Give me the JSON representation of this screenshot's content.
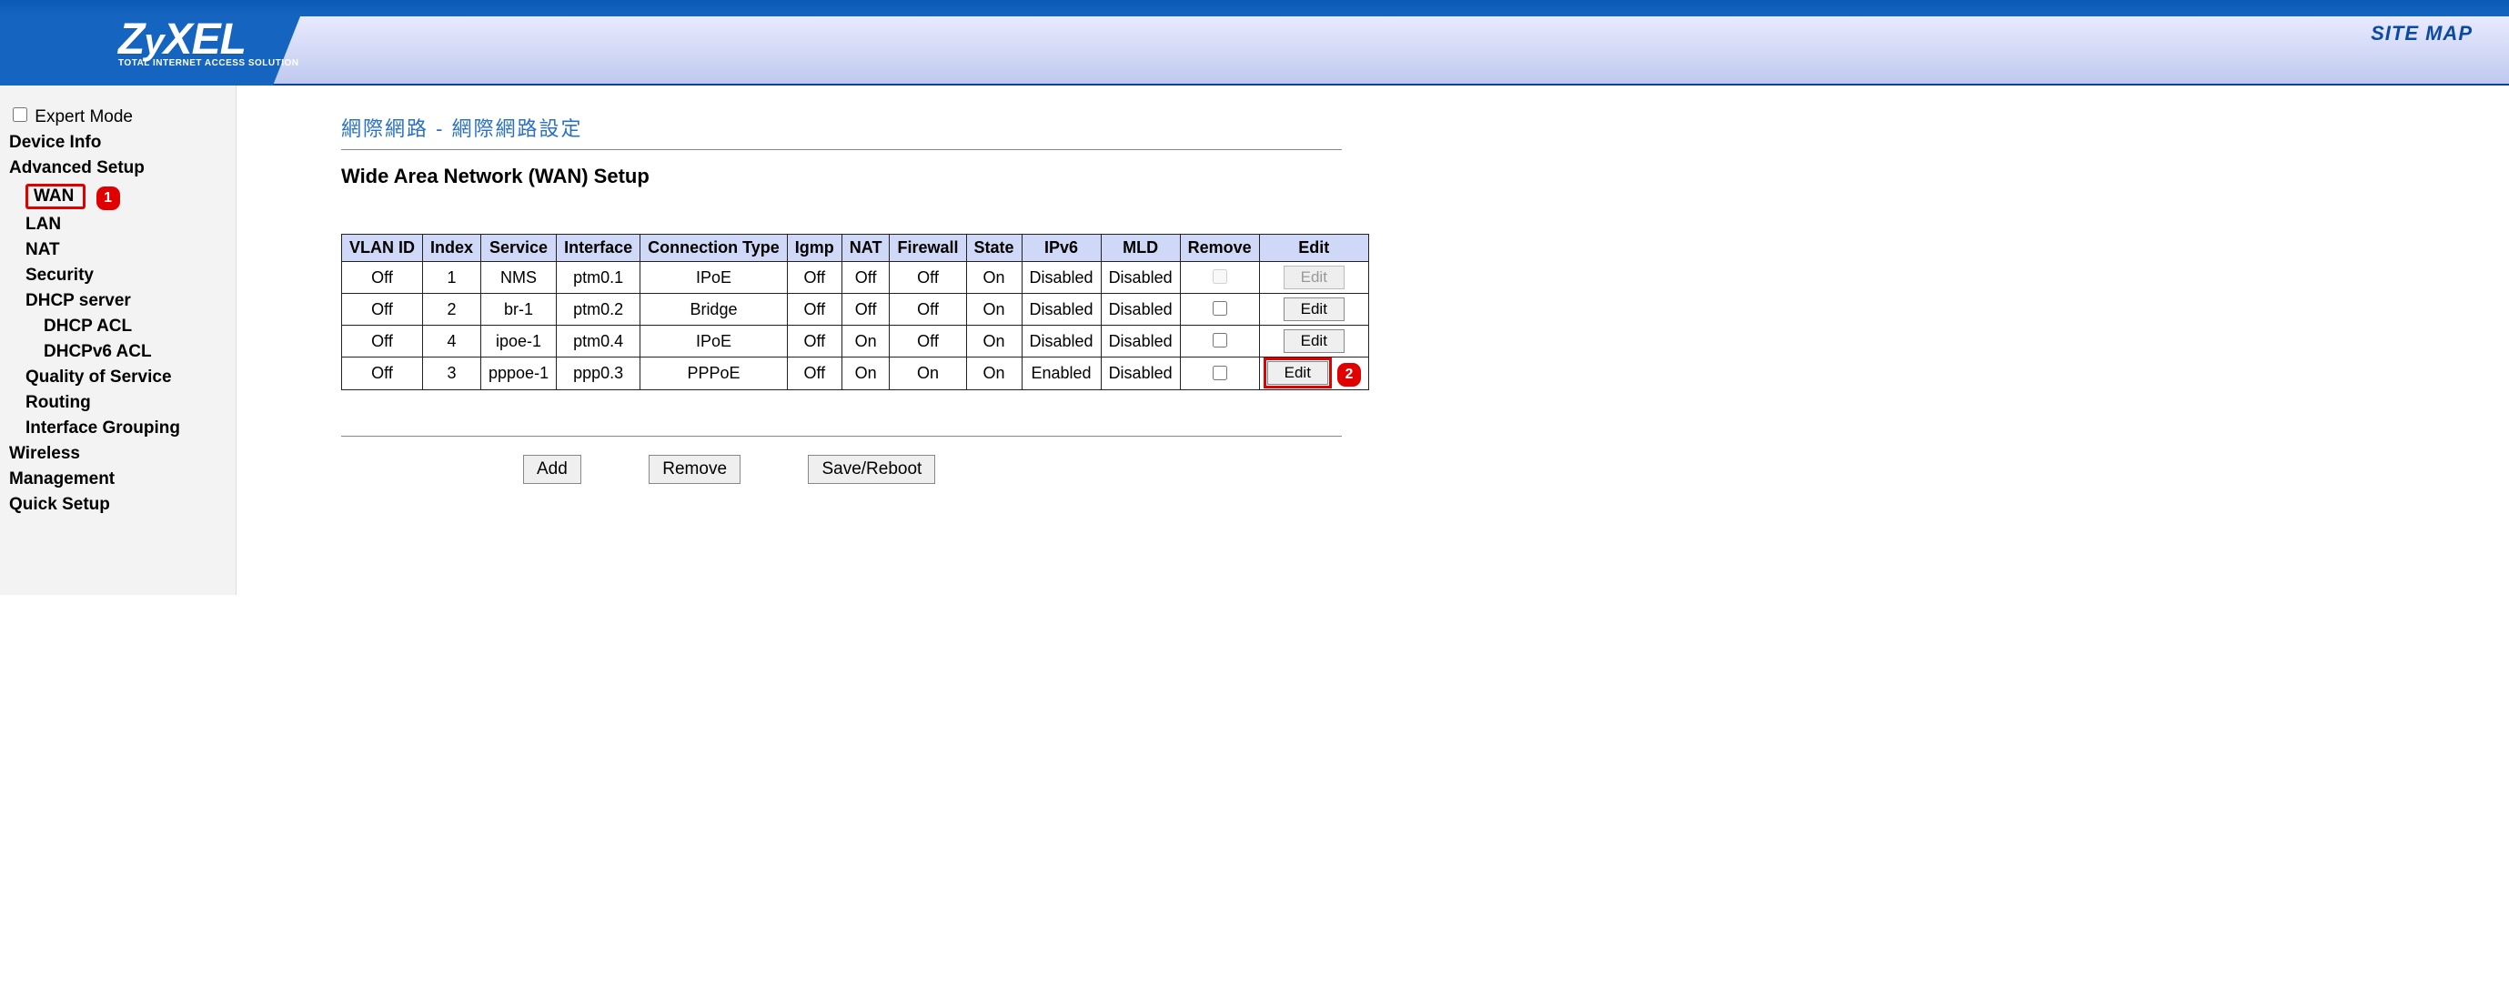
{
  "header": {
    "brand_main": "ZyXEL",
    "brand_sub": "TOTAL INTERNET ACCESS SOLUTION",
    "sitemap_label": "SITE MAP"
  },
  "sidebar": {
    "expert_mode_label": "Expert Mode",
    "expert_mode_checked": false,
    "device_info": "Device Info",
    "advanced_setup": "Advanced Setup",
    "wan": "WAN",
    "lan": "LAN",
    "nat": "NAT",
    "security": "Security",
    "dhcp_server": "DHCP server",
    "dhcp_acl": "DHCP ACL",
    "dhcpv6_acl": "DHCPv6 ACL",
    "qos": "Quality of Service",
    "routing": "Routing",
    "if_grouping": "Interface Grouping",
    "wireless": "Wireless",
    "management": "Management",
    "quick_setup": "Quick Setup"
  },
  "annotations": {
    "badge1": "1",
    "badge2": "2"
  },
  "main": {
    "breadcrumb": "網際網路 - 網際網路設定",
    "title": "Wide Area Network (WAN) Setup",
    "columns": [
      "VLAN ID",
      "Index",
      "Service",
      "Interface",
      "Connection Type",
      "Igmp",
      "NAT",
      "Firewall",
      "State",
      "IPv6",
      "MLD",
      "Remove",
      "Edit"
    ],
    "rows": [
      {
        "vlan": "Off",
        "index": "1",
        "service": "NMS",
        "iface": "ptm0.1",
        "conn": "IPoE",
        "igmp": "Off",
        "nat": "Off",
        "fw": "Off",
        "state": "On",
        "ipv6": "Disabled",
        "mld": "Disabled",
        "remove_enabled": false,
        "edit_label": "Edit",
        "edit_enabled": false,
        "highlight": false
      },
      {
        "vlan": "Off",
        "index": "2",
        "service": "br-1",
        "iface": "ptm0.2",
        "conn": "Bridge",
        "igmp": "Off",
        "nat": "Off",
        "fw": "Off",
        "state": "On",
        "ipv6": "Disabled",
        "mld": "Disabled",
        "remove_enabled": true,
        "edit_label": "Edit",
        "edit_enabled": true,
        "highlight": false
      },
      {
        "vlan": "Off",
        "index": "4",
        "service": "ipoe-1",
        "iface": "ptm0.4",
        "conn": "IPoE",
        "igmp": "Off",
        "nat": "On",
        "fw": "Off",
        "state": "On",
        "ipv6": "Disabled",
        "mld": "Disabled",
        "remove_enabled": true,
        "edit_label": "Edit",
        "edit_enabled": true,
        "highlight": false
      },
      {
        "vlan": "Off",
        "index": "3",
        "service": "pppoe-1",
        "iface": "ppp0.3",
        "conn": "PPPoE",
        "igmp": "Off",
        "nat": "On",
        "fw": "On",
        "state": "On",
        "ipv6": "Enabled",
        "mld": "Disabled",
        "remove_enabled": true,
        "edit_label": "Edit",
        "edit_enabled": true,
        "highlight": true
      }
    ],
    "buttons": {
      "add": "Add",
      "remove": "Remove",
      "save_reboot": "Save/Reboot"
    }
  }
}
